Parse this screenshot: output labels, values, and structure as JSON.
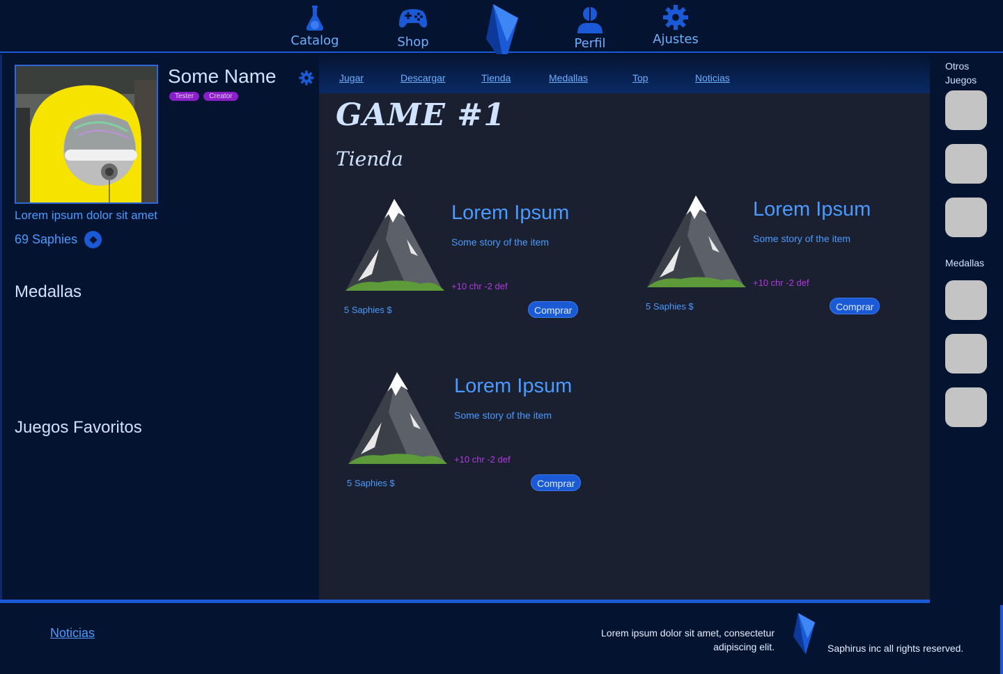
{
  "topnav": {
    "items": [
      {
        "label": "Catalog",
        "icon": "flask-icon"
      },
      {
        "label": "Shop",
        "icon": "gamepad-icon"
      },
      {
        "label": "Perfil",
        "icon": "user-icon"
      },
      {
        "label": "Ajustes",
        "icon": "gear-icon"
      }
    ],
    "logo": "saphire-crystal-icon"
  },
  "profile": {
    "name": "Some Name",
    "badges": [
      "Tester",
      "Creator"
    ],
    "bio": "Lorem ipsum dolor sit amet",
    "saphies": "69 Saphies",
    "sections": {
      "medals": "Medallas",
      "favorites": "Juegos Favoritos"
    }
  },
  "subnav": {
    "links": [
      "Jugar",
      "Descargar",
      "Tienda",
      "Medallas",
      "Top",
      "Noticias"
    ]
  },
  "main": {
    "game_title": "GAME #1",
    "section": "Tienda",
    "items": [
      {
        "name": "Lorem Ipsum",
        "story": "Some story of the item",
        "stats": "+10 chr -2 def",
        "price": "5 Saphies $",
        "buy": "Comprar"
      },
      {
        "name": "Lorem Ipsum",
        "story": "Some story of the item",
        "stats": "+10 chr -2 def",
        "price": "5 Saphies $",
        "buy": "Comprar"
      },
      {
        "name": "Lorem Ipsum",
        "story": "Some story of the item",
        "stats": "+10 chr -2 def",
        "price": "5 Saphies $",
        "buy": "Comprar"
      }
    ]
  },
  "rightbar": {
    "other_games": "Otros Juegos",
    "medals": "Medallas"
  },
  "footer": {
    "news": "Noticias",
    "description": "Lorem ipsum dolor sit amet, consectetur adipiscing elit.",
    "rights": "Saphirus inc all rights reserved."
  },
  "colors": {
    "background": "#041430",
    "panel": "#1b2030",
    "accent": "#1b5ad6",
    "link": "#4a9aff",
    "badge": "#8a1fc9",
    "stats": "#b03ae0"
  }
}
